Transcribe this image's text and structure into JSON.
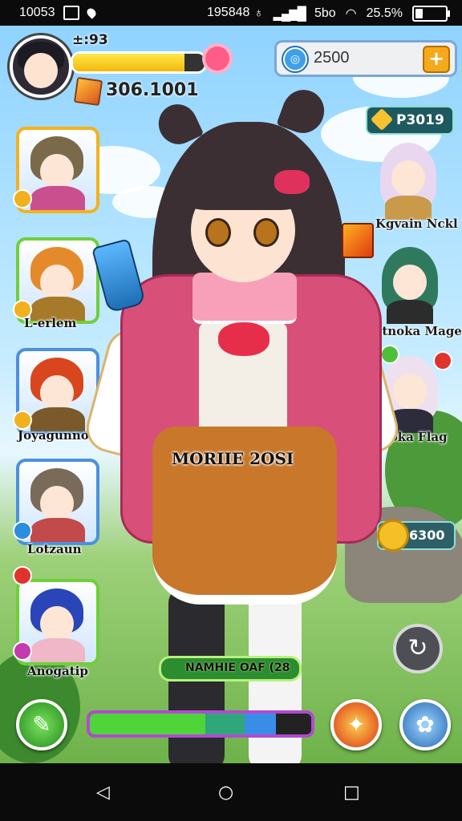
{
  "status_bar": {
    "time": "10053",
    "center_text": "195848",
    "network": "5bo",
    "battery": "25.5%",
    "battery_level": 0.26
  },
  "player": {
    "level_text": "±:93",
    "hp_fill": 0.85,
    "coins": "306.1001"
  },
  "currency": {
    "gems": "2500",
    "plus_label": "+",
    "gold": "P3019"
  },
  "left_roster": [
    {
      "label": "",
      "hair": "#7a6a4a",
      "border": "#f4b21a",
      "body": "#c94f8f"
    },
    {
      "label": "L-erlem",
      "hair": "#e58a2a",
      "border": "#6fcf3a",
      "body": "#a77a2a"
    },
    {
      "label": "Joyagunno",
      "hair": "#d9461e",
      "border": "#4a90e2",
      "body": "#7a5a2a"
    },
    {
      "label": "Lotzaun",
      "hair": "#7a6a5a",
      "border": "#4a90e2",
      "body": "#c24a4a"
    },
    {
      "label": "Anogatip",
      "hair": "#2a45b8",
      "border": "#6fcf3a",
      "body": "#f0b7c8"
    }
  ],
  "right_roster": [
    {
      "label": "Kgvain Nckl",
      "hair": "#e9d7ef",
      "body": "#c99a4a"
    },
    {
      "label": "Matnoka Mage",
      "hair": "#2f7a5e",
      "body": "#2c2c2c"
    },
    {
      "label": "Noka Flag",
      "hair": "#efe0ef",
      "body": "#2c2c3c"
    }
  ],
  "hero": {
    "label": "MORIIE 2OSI",
    "name_label": "NAMHIE OAF (28"
  },
  "side_coins": "6300",
  "refresh_icon": "↻",
  "exp_bar": {
    "segments": [
      {
        "fill": 0.52,
        "color": "#4fd43a"
      },
      {
        "fill": 0.18,
        "color": "#2fa77a"
      },
      {
        "fill": 0.14,
        "color": "#3a8de6"
      }
    ]
  },
  "bottom_buttons": {
    "left_icon": "✎",
    "fire_icon": "✦",
    "gear_icon": "✿"
  },
  "nav": {
    "back": "◁",
    "home": "○",
    "recent": "□"
  }
}
